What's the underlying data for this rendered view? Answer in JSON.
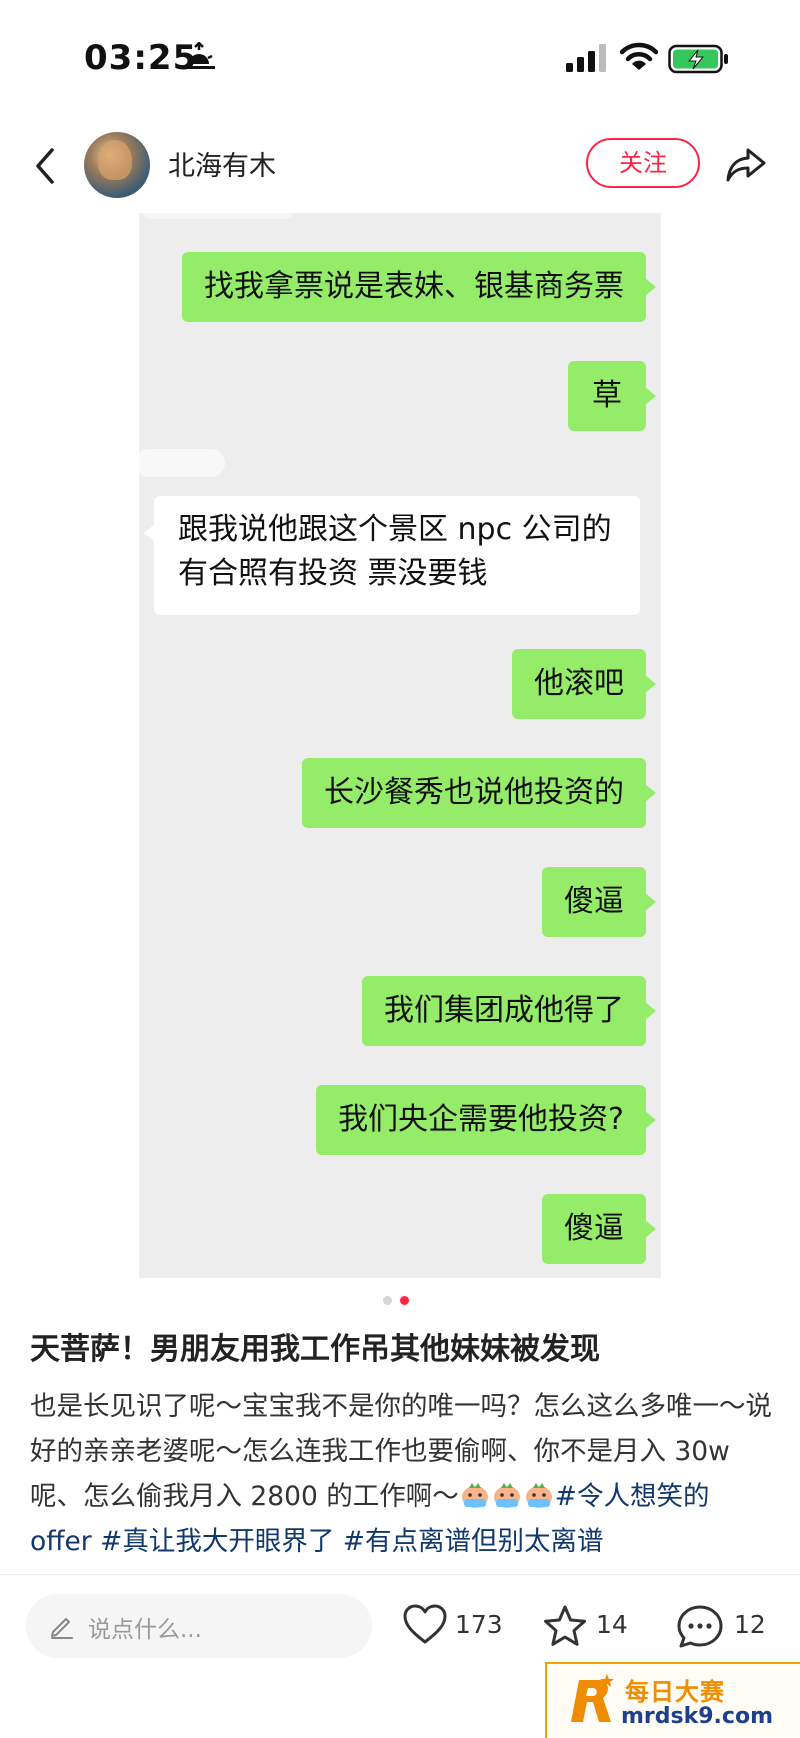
{
  "status_bar": {
    "time": "03:25"
  },
  "header": {
    "author": "北海有木",
    "follow_label": "关注"
  },
  "chat_messages": [
    {
      "side": "right",
      "text": "找我拿票说是表妹、银基商务票"
    },
    {
      "side": "right",
      "text": "草"
    },
    {
      "side": "left",
      "lines": [
        "跟我说他跟这个景区 npc 公司的",
        "有合照有投资 票没要钱"
      ]
    },
    {
      "side": "right",
      "text": "他滚吧"
    },
    {
      "side": "right",
      "text": "长沙餐秀也说他投资的"
    },
    {
      "side": "right",
      "text": "傻逼"
    },
    {
      "side": "right",
      "text": "我们集团成他得了"
    },
    {
      "side": "right",
      "text": "我们央企需要他投资?"
    },
    {
      "side": "right",
      "text": "傻逼"
    }
  ],
  "pager": {
    "active_index": 1,
    "total": 2
  },
  "post": {
    "title": "天菩萨！男朋友用我工作吊其他妹妹被发现",
    "body": "也是长见识了呢～宝宝我不是你的唯一吗？怎么这么多唯一～说好的亲亲老婆呢～怎么连我工作也要偷啊、你不是月入 30w呢、怎么偷我月入 2800 的工作啊～",
    "tags": [
      "#令人想笑的 offer",
      "#真让我大开眼界了",
      "#有点离谱但别太离谱"
    ]
  },
  "bottom_bar": {
    "comment_placeholder": "说点什么...",
    "likes": "173",
    "favorites": "14",
    "comments": "12"
  },
  "watermark": {
    "title": "每日大赛",
    "url": "mrdsk9.com"
  },
  "colors": {
    "accent": "#ff2442",
    "bubble_green": "#95ec69",
    "chat_bg": "#ededed",
    "tag_blue": "#13386c"
  }
}
